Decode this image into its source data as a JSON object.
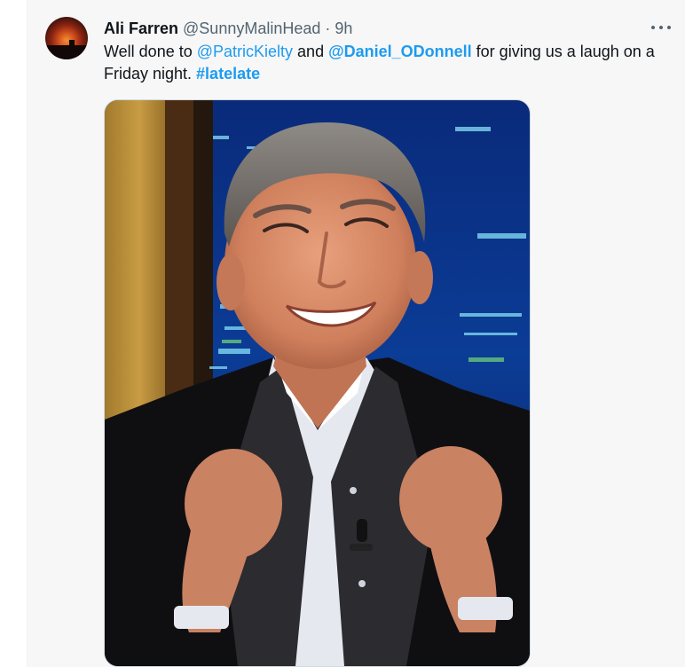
{
  "tweet": {
    "author_name": "Ali Farren",
    "author_handle": "@SunnyMalinHead",
    "separator": "·",
    "time": "9h",
    "text": {
      "part1": "Well done to ",
      "mention1": "@PatricKielty",
      "part2": " and ",
      "mention2": "@Daniel_ODonnell",
      "part3": " for giving us a laugh on a Friday night. ",
      "hashtag": "#latelate"
    },
    "more_icon": "more-horizontal-icon",
    "avatar": "sunset-avatar",
    "media": "photo-smiling-man-in-tuxedo"
  },
  "colors": {
    "link": "#1d9bf0",
    "name": "#0f1419",
    "secondary": "#536471",
    "background": "#f7f7f7"
  }
}
